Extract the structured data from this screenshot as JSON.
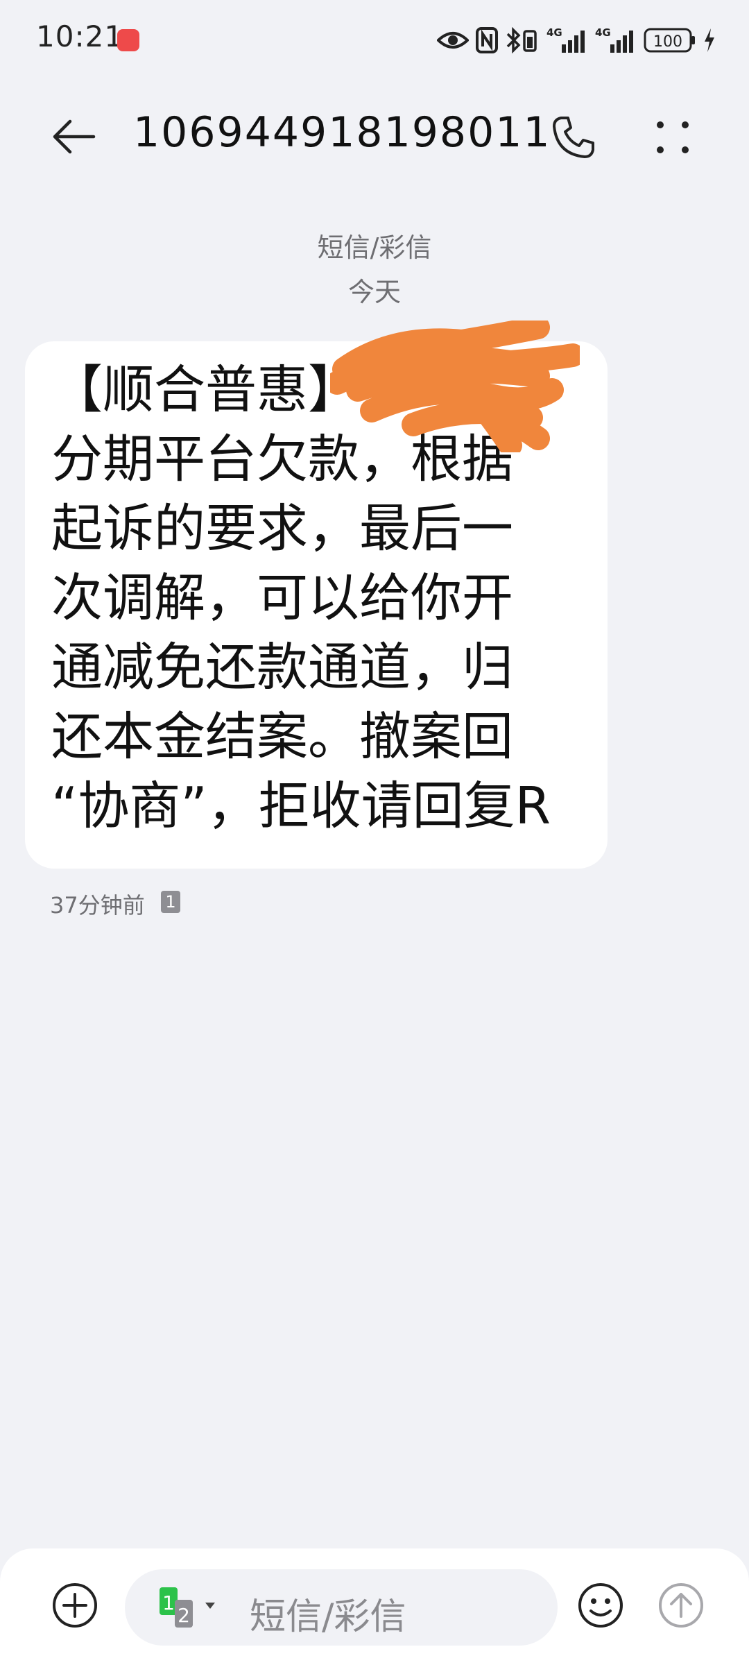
{
  "status_bar": {
    "time": "10:21",
    "battery": "100",
    "network_1": "4G",
    "network_2": "4G",
    "icons": [
      "app-notification-icon",
      "eye-icon",
      "nfc-icon",
      "bluetooth-battery-icon",
      "signal-4g-icon",
      "signal-4g-icon",
      "battery-icon",
      "charging-icon"
    ]
  },
  "header": {
    "title": "106944918198011",
    "icons": [
      "back-arrow-icon",
      "phone-icon",
      "more-icon"
    ]
  },
  "conversation": {
    "type_label": "短信/彩信",
    "date_label": "今天"
  },
  "message": {
    "lines": [
      "【顺合普惠】",
      "分期平台欠款，根据",
      "起诉的要求，最后一",
      "次调解，可以给你开",
      "通减免还款通道，归",
      "还本金结案。撤案回",
      "“协商”，拒收请回复R"
    ],
    "timestamp": "37分钟前",
    "sim_slot": "1"
  },
  "composer": {
    "placeholder": "短信/彩信",
    "sim_primary": "1",
    "sim_secondary": "2",
    "icons": [
      "add-icon",
      "sim-select-icon",
      "emoji-icon",
      "send-icon"
    ]
  },
  "colors": {
    "background": "#f1f2f6",
    "bubble": "#ffffff",
    "redaction": "#f0863c",
    "sim_green": "#2cc24a"
  }
}
